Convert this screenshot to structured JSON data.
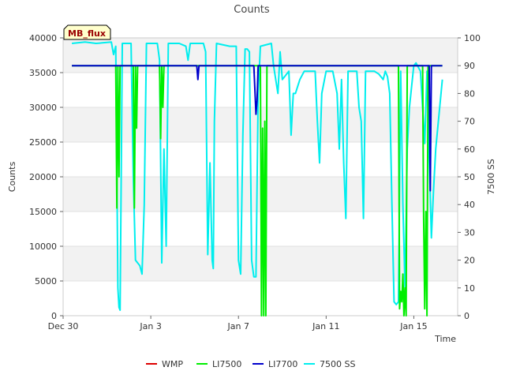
{
  "chart_data": {
    "type": "line",
    "title": "Counts",
    "annotation": "MB_flux",
    "xlabel": "Time",
    "ylabel_left": "Counts",
    "ylabel_right": "7500 SS",
    "x_unit": "days since Dec 30",
    "xlim": [
      0,
      18
    ],
    "ylim_left": [
      0,
      40000
    ],
    "ylim_right": [
      0,
      100
    ],
    "grid": true,
    "legend_position": "bottom",
    "x_ticks": [
      {
        "x": 0,
        "label": "Dec 30"
      },
      {
        "x": 4,
        "label": "Jan 3"
      },
      {
        "x": 8,
        "label": "Jan 7"
      },
      {
        "x": 12,
        "label": "Jan 11"
      },
      {
        "x": 16,
        "label": "Jan 15"
      }
    ],
    "y_ticks_left": [
      0,
      5000,
      10000,
      15000,
      20000,
      25000,
      30000,
      35000,
      40000
    ],
    "y_ticks_right": [
      0,
      10,
      20,
      30,
      40,
      50,
      60,
      70,
      80,
      90,
      100
    ],
    "series": [
      {
        "name": "WMP",
        "color": "#dd0000",
        "axis": "left",
        "points": []
      },
      {
        "name": "LI7500",
        "color": "#00ee00",
        "axis": "left",
        "points": [
          [
            0.4,
            36000
          ],
          [
            2.4,
            36000
          ],
          [
            2.45,
            15500
          ],
          [
            2.5,
            36000
          ],
          [
            2.55,
            20000
          ],
          [
            2.6,
            36000
          ],
          [
            3.2,
            36000
          ],
          [
            3.25,
            15500
          ],
          [
            3.3,
            36000
          ],
          [
            3.35,
            27000
          ],
          [
            3.4,
            36000
          ],
          [
            4.4,
            36000
          ],
          [
            4.45,
            25500
          ],
          [
            4.5,
            36000
          ],
          [
            4.55,
            30000
          ],
          [
            4.6,
            36000
          ],
          [
            8.9,
            36000
          ],
          [
            9.0,
            36000
          ],
          [
            9.05,
            0
          ],
          [
            9.1,
            27000
          ],
          [
            9.15,
            0
          ],
          [
            9.2,
            28000
          ],
          [
            9.25,
            0
          ],
          [
            9.3,
            36000
          ],
          [
            9.35,
            36000
          ],
          [
            15.3,
            36000
          ],
          [
            15.35,
            1000
          ],
          [
            15.4,
            3500
          ],
          [
            15.45,
            2000
          ],
          [
            15.5,
            6000
          ],
          [
            15.55,
            0
          ],
          [
            15.6,
            4000
          ],
          [
            15.65,
            0
          ],
          [
            15.7,
            36000
          ],
          [
            16.4,
            36000
          ],
          [
            16.45,
            14000
          ],
          [
            16.5,
            1000
          ],
          [
            16.55,
            15000
          ],
          [
            16.6,
            0
          ],
          [
            16.65,
            36000
          ],
          [
            17.3,
            36000
          ]
        ]
      },
      {
        "name": "LI7700",
        "color": "#0000cc",
        "axis": "left",
        "points": [
          [
            0.4,
            36000
          ],
          [
            6.1,
            36000
          ],
          [
            6.15,
            34000
          ],
          [
            6.2,
            36000
          ],
          [
            8.7,
            36000
          ],
          [
            8.8,
            29000
          ],
          [
            8.85,
            31000
          ],
          [
            8.9,
            36000
          ],
          [
            16.7,
            36000
          ],
          [
            16.75,
            18000
          ],
          [
            16.8,
            36000
          ],
          [
            17.3,
            36000
          ]
        ]
      },
      {
        "name": "7500 SS",
        "color": "#00eeee",
        "axis": "right",
        "points": [
          [
            0.4,
            98
          ],
          [
            1.0,
            98.5
          ],
          [
            1.5,
            98
          ],
          [
            2.2,
            98.5
          ],
          [
            2.3,
            94
          ],
          [
            2.4,
            97
          ],
          [
            2.5,
            10
          ],
          [
            2.55,
            3
          ],
          [
            2.6,
            2
          ],
          [
            2.7,
            98
          ],
          [
            3.1,
            98
          ],
          [
            3.2,
            50
          ],
          [
            3.3,
            20
          ],
          [
            3.5,
            18
          ],
          [
            3.6,
            15
          ],
          [
            3.7,
            40
          ],
          [
            3.8,
            98
          ],
          [
            4.3,
            98
          ],
          [
            4.4,
            92
          ],
          [
            4.5,
            19
          ],
          [
            4.6,
            60
          ],
          [
            4.7,
            25
          ],
          [
            4.8,
            98
          ],
          [
            5.3,
            98
          ],
          [
            5.6,
            97
          ],
          [
            5.7,
            92
          ],
          [
            5.8,
            98
          ],
          [
            6.4,
            98
          ],
          [
            6.5,
            95
          ],
          [
            6.6,
            22
          ],
          [
            6.7,
            55
          ],
          [
            6.8,
            20
          ],
          [
            6.85,
            17
          ],
          [
            6.9,
            70
          ],
          [
            7.0,
            98
          ],
          [
            7.6,
            97
          ],
          [
            7.9,
            97
          ],
          [
            8.0,
            20
          ],
          [
            8.1,
            15
          ],
          [
            8.2,
            65
          ],
          [
            8.3,
            96
          ],
          [
            8.4,
            96
          ],
          [
            8.5,
            95
          ],
          [
            8.6,
            20
          ],
          [
            8.7,
            14
          ],
          [
            8.8,
            14
          ],
          [
            8.9,
            80
          ],
          [
            9.0,
            97
          ],
          [
            9.5,
            98
          ],
          [
            9.6,
            90
          ],
          [
            9.8,
            80
          ],
          [
            9.9,
            95
          ],
          [
            10.0,
            85
          ],
          [
            10.3,
            88
          ],
          [
            10.4,
            65
          ],
          [
            10.5,
            80
          ],
          [
            10.6,
            80
          ],
          [
            10.8,
            85
          ],
          [
            11.0,
            88
          ],
          [
            11.5,
            88
          ],
          [
            11.6,
            70
          ],
          [
            11.7,
            55
          ],
          [
            11.8,
            80
          ],
          [
            12.0,
            88
          ],
          [
            12.3,
            88
          ],
          [
            12.5,
            80
          ],
          [
            12.6,
            60
          ],
          [
            12.7,
            85
          ],
          [
            12.8,
            55
          ],
          [
            12.9,
            35
          ],
          [
            13.0,
            88
          ],
          [
            13.4,
            88
          ],
          [
            13.5,
            75
          ],
          [
            13.6,
            70
          ],
          [
            13.7,
            35
          ],
          [
            13.8,
            88
          ],
          [
            14.2,
            88
          ],
          [
            14.4,
            87
          ],
          [
            14.6,
            85
          ],
          [
            14.7,
            88
          ],
          [
            14.8,
            86
          ],
          [
            14.9,
            80
          ],
          [
            15.0,
            40
          ],
          [
            15.1,
            5
          ],
          [
            15.2,
            4
          ],
          [
            15.3,
            5
          ],
          [
            15.4,
            88
          ],
          [
            15.5,
            40
          ],
          [
            15.6,
            10
          ],
          [
            15.7,
            60
          ],
          [
            15.8,
            75
          ],
          [
            16.0,
            90
          ],
          [
            16.1,
            91
          ],
          [
            16.3,
            88
          ],
          [
            16.5,
            62
          ],
          [
            16.6,
            88
          ],
          [
            16.8,
            28
          ],
          [
            16.9,
            45
          ],
          [
            17.0,
            60
          ],
          [
            17.3,
            85
          ]
        ]
      }
    ]
  }
}
